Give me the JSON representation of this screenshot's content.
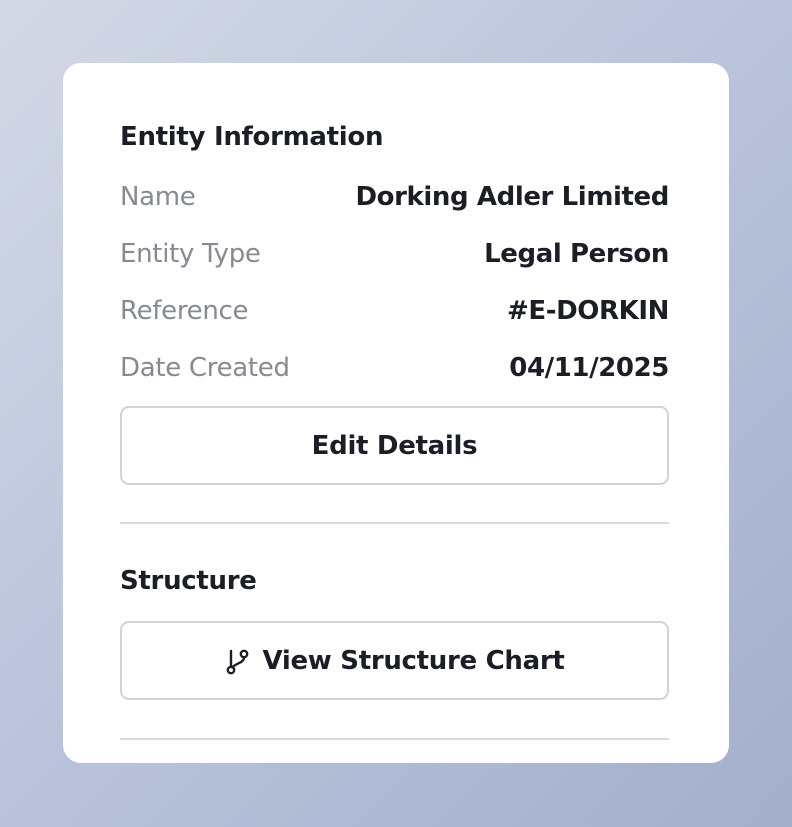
{
  "entity_information": {
    "title": "Entity Information",
    "fields": [
      {
        "label": "Name",
        "value": "Dorking Adler Limited"
      },
      {
        "label": "Entity Type",
        "value": "Legal Person"
      },
      {
        "label": "Reference",
        "value": "#E-DORKIN"
      },
      {
        "label": "Date Created",
        "value": "04/11/2025"
      }
    ],
    "edit_button_label": "Edit Details"
  },
  "structure": {
    "title": "Structure",
    "view_chart_button_label": "View Structure Chart",
    "view_chart_button_icon": "git-branch-icon"
  }
}
